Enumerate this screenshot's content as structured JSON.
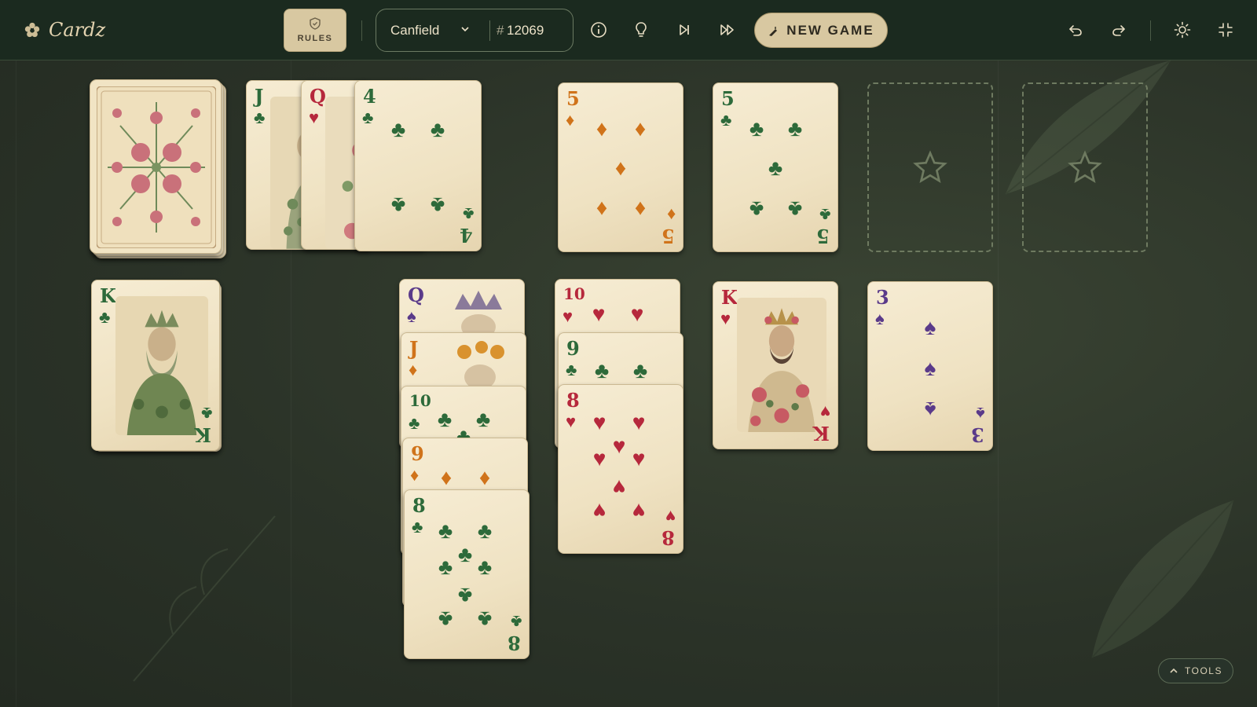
{
  "app": {
    "name": "Cardz"
  },
  "toolbar": {
    "rules_label": "RULES",
    "game_type": "Canfield",
    "game_hash": "#",
    "game_number": "12069",
    "new_game_label": "NEW GAME",
    "icons": [
      "info-icon",
      "hint-icon",
      "step-icon",
      "autoplay-icon",
      "undo-icon",
      "redo-icon",
      "brightness-icon",
      "collapse-icon"
    ]
  },
  "tools_label": "TOOLS",
  "colors": {
    "felt": "#2b3327",
    "topbar": "#1b2a1f",
    "accent_cream": "#d8c8a1",
    "red": "#b6283c",
    "orange": "#d0731a",
    "green": "#2d6a3a",
    "purple": "#5a3a8a"
  },
  "board": {
    "stock": {
      "face": "down"
    },
    "waste": [
      {
        "rank": "J",
        "suit": "♣",
        "color": "green"
      },
      {
        "rank": "Q",
        "suit": "♥",
        "color": "red"
      },
      {
        "rank": "4",
        "suit": "♣",
        "color": "green"
      }
    ],
    "foundations": [
      {
        "rank": "5",
        "suit": "♦",
        "color": "orange"
      },
      {
        "rank": "5",
        "suit": "♣",
        "color": "green"
      },
      {
        "empty": true
      },
      {
        "empty": true
      }
    ],
    "reserve": {
      "rank": "K",
      "suit": "♣",
      "color": "green"
    },
    "tableau": [
      [
        {
          "rank": "Q",
          "suit": "♠",
          "color": "purple"
        },
        {
          "rank": "J",
          "suit": "♦",
          "color": "orange"
        },
        {
          "rank": "10",
          "suit": "♣",
          "color": "green"
        },
        {
          "rank": "9",
          "suit": "♦",
          "color": "orange"
        },
        {
          "rank": "8",
          "suit": "♣",
          "color": "green"
        }
      ],
      [
        {
          "rank": "10",
          "suit": "♥",
          "color": "red"
        },
        {
          "rank": "9",
          "suit": "♣",
          "color": "green"
        },
        {
          "rank": "8",
          "suit": "♥",
          "color": "red"
        }
      ],
      [
        {
          "rank": "K",
          "suit": "♥",
          "color": "red"
        }
      ],
      [
        {
          "rank": "3",
          "suit": "♠",
          "color": "purple"
        }
      ]
    ]
  }
}
